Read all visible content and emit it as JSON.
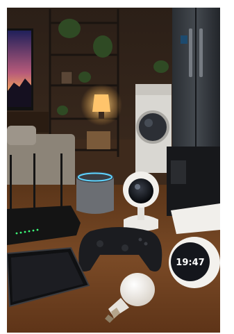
{
  "photo": {
    "background": "#ffffff",
    "clock_time": "19:47",
    "colors": {
      "wall": "#3a2a1e",
      "floor": "#6b4326",
      "table": "#7a4a26",
      "lamp_glow": "#ffc46b",
      "speaker_ring": "#5fd4ff",
      "router_led": "#3cff7a",
      "tv_sky_top": "#2a2a6e",
      "tv_sky_mid": "#b65a7a",
      "tv_sky_low": "#f0a15a"
    },
    "objects": [
      "tv-icon",
      "shelf-icon",
      "lamp-icon",
      "plant-icon",
      "washing-machine-icon",
      "refrigerator-icon",
      "sofa-icon",
      "router-icon",
      "smart-speaker-icon",
      "security-camera-icon",
      "printer-icon",
      "game-controller-icon",
      "tablet-icon",
      "light-bulb-icon",
      "smart-clock-icon"
    ]
  }
}
